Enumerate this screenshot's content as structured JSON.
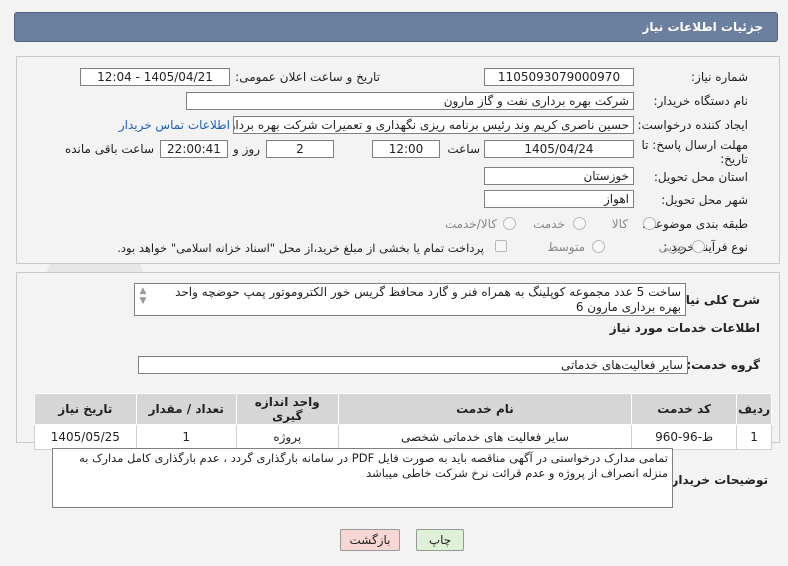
{
  "header": {
    "title": "جزئیات اطلاعات نیاز"
  },
  "fields": {
    "need_number_label": "شماره نیاز:",
    "need_number": "1105093079000970",
    "announce_label": "تاریخ و ساعت اعلان عمومی:",
    "announce_value": "1405/04/21 - 12:04",
    "buyer_org_label": "نام دستگاه خریدار:",
    "buyer_org": "شرکت بهره برداری نفت و گاز مارون",
    "creator_label": "ایجاد کننده درخواست:",
    "creator": "حسین ناصری کریم وند رئیس برنامه ریزی نگهداری و تعمیرات شرکت بهره برداری نفت و گاز مارون",
    "contact_link": "اطلاعات تماس خریدار",
    "deadline_label": "مهلت ارسال پاسخ: تا تاریخ:",
    "deadline_date": "1405/04/24",
    "time_label": "ساعت",
    "deadline_time": "12:00",
    "days_value": "2",
    "days_label": "روز و",
    "remaining_time": "22:00:41",
    "remaining_label": "ساعت باقی مانده",
    "province_label": "استان محل تحویل:",
    "province": "خوزستان",
    "city_label": "شهر محل تحویل:",
    "city": "اهواز",
    "category_label": "طبقه بندی موضوعی:",
    "category_options": [
      "کالا",
      "خدمت",
      "کالا/خدمت"
    ],
    "purchase_type_label": "نوع فرآیند خرید :",
    "purchase_type_options": [
      "جزیی",
      "متوسط"
    ],
    "payment_note": "پرداخت تمام یا بخشی از مبلغ خرید،از محل \"اسناد خزانه اسلامی\" خواهد بود."
  },
  "description": {
    "label": "شرح کلی نیاز:",
    "text": "ساخت 5 عدد مجموعه کوپلینگ به همراه فنر و گارد محافظ گریس خور الکتروموتور پمپ حوضچه واحد بهره برداری مارون 6"
  },
  "services": {
    "section_title": "اطلاعات خدمات مورد نیاز",
    "group_label": "گروه خدمت:",
    "group_value": "سایر فعالیت‌های خدماتی",
    "columns": [
      "ردیف",
      "کد خدمت",
      "نام خدمت",
      "واحد اندازه گیری",
      "تعداد / مقدار",
      "تاریخ نیاز"
    ],
    "rows": [
      [
        "1",
        "ط-96-960",
        "سایر فعالیت های خدماتی شخصی",
        "پروژه",
        "1",
        "1405/05/25"
      ]
    ]
  },
  "buyer_notes": {
    "label": "توضیحات خریدار:",
    "text": "تمامی مدارک درخواستی در آگهی مناقصه باید به صورت فایل PDF در سامانه بارگذاری گردد ، عدم بارگذاری کامل مدارک به منزله انصراف از پروژه و عدم قرائت نرخ شرکت خاطی میباشد"
  },
  "buttons": {
    "print": "چاپ",
    "back": "بازگشت"
  },
  "watermark": "AriaTender.net",
  "colors": {
    "header": "#6b7f9e",
    "link": "#1f5fbf",
    "print_btn": "#dff2d8",
    "back_btn": "#f7d6d6"
  }
}
